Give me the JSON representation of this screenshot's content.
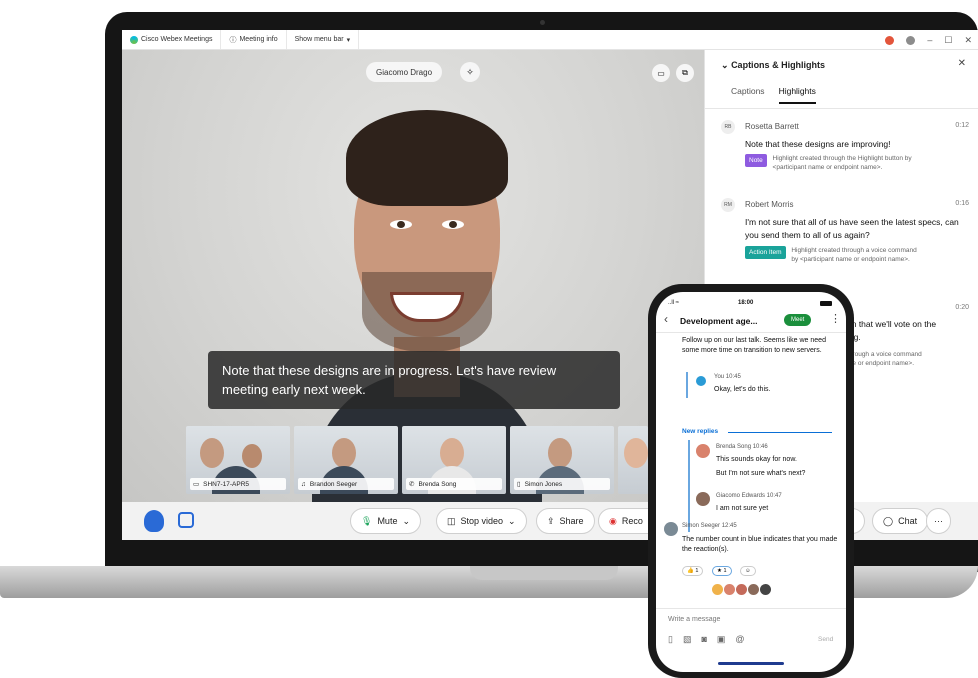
{
  "titlebar": {
    "app_name": "Cisco Webex Meetings",
    "meeting_info": "Meeting info",
    "show_menu_bar": "Show menu bar",
    "chevron": "▾",
    "minimize": "–",
    "maximize": "☐",
    "close": "✕"
  },
  "video": {
    "speaker_name": "Giacomo Drago",
    "caption_text": "Note that these designs are in progress. Let's have review meeting early next week.",
    "thumbnails": [
      {
        "label": "SHN7-17-APR5",
        "icon": "monitor-icon"
      },
      {
        "label": "Brandon Seeger",
        "icon": "headset-icon"
      },
      {
        "label": "Brenda Song",
        "icon": "phone-icon"
      },
      {
        "label": "Simon Jones",
        "icon": "phone-icon"
      }
    ]
  },
  "controls": {
    "mute": "Mute",
    "stop_video": "Stop video",
    "share": "Share",
    "record": "Reco",
    "participants": "nts",
    "chat": "Chat",
    "more": "···"
  },
  "panel": {
    "title": "Captions & Highlights",
    "close": "✕",
    "tab_captions": "Captions",
    "tab_highlights": "Highlights",
    "entries": [
      {
        "initials": "RB",
        "name": "Rosetta Barrett",
        "time": "0:12",
        "text": "Note that these designs are improving!",
        "tag": "Note",
        "meta": "Highlight created through the Highlight button by <participant name or endpoint name>."
      },
      {
        "initials": "RM",
        "name": "Robert Morris",
        "time": "0:16",
        "text": "I'm not sure that all of us have seen the latest specs, can you send them to all of us again?",
        "tag": "Action Item",
        "meta": "Highlight created through a voice command by <participant name or endpoint name>."
      },
      {
        "time": "0:20",
        "text_partial_1": "on that we'll vote on the",
        "text_partial_2": "ing.",
        "meta_partial_1": "through a voice command",
        "meta_partial_2": "me or endpoint name>."
      }
    ]
  },
  "phone": {
    "status_time": "18:00",
    "signal": "..ll ≈",
    "chat_title": "Development age...",
    "meet_button": "Meet",
    "msg1": "Follow up on our last talk. Seems like we need some more time on transition to new servers.",
    "you_meta": "You  10:45",
    "you_text": "Okay, let's do this.",
    "new_replies": "New replies",
    "brenda_meta": "Brenda Song  10:46",
    "brenda_text_1": "This sounds okay for now.",
    "brenda_text_2": "But I'm not sure what's next?",
    "giacomo_meta": "Giacomo Edwards  10:47",
    "giacomo_text": "I am not sure yet",
    "simon_meta": "Simon Seeger  12:45",
    "simon_text": "The number count in blue indicates that you made the reaction(s).",
    "reactions": [
      "👍 1",
      "★ 1",
      "☺"
    ],
    "write_placeholder": "Write a message",
    "send": "Send"
  }
}
